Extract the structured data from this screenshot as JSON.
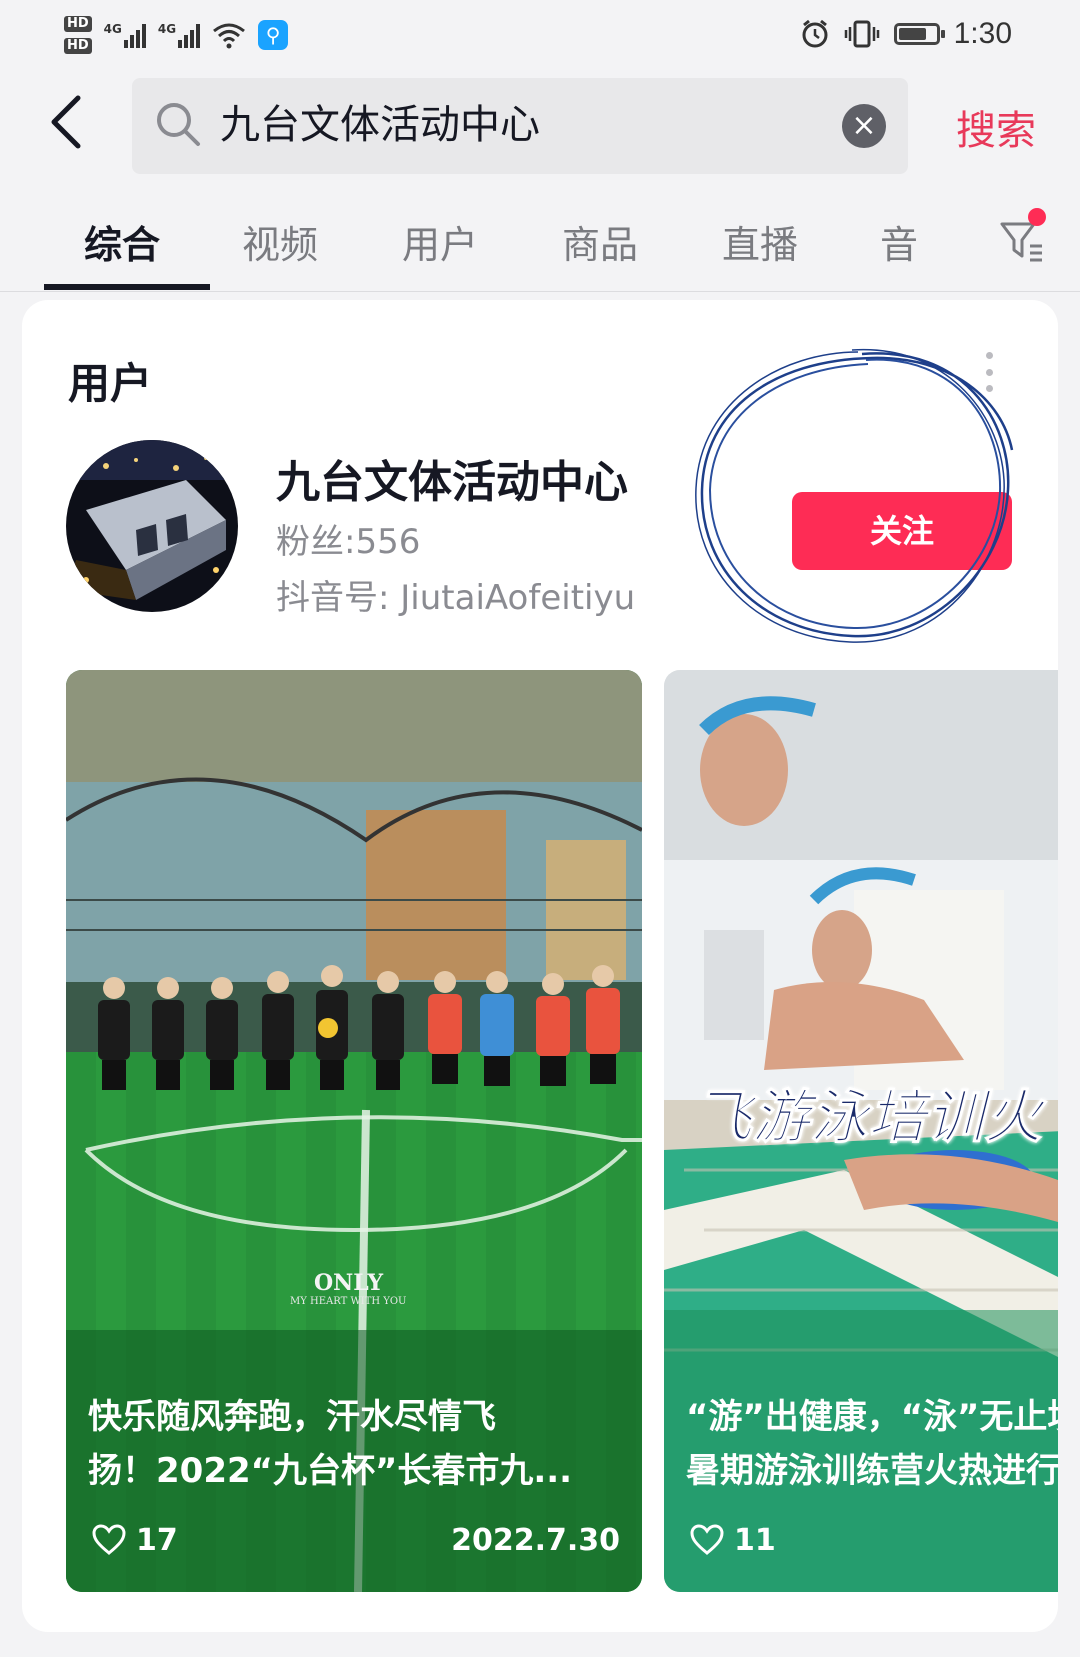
{
  "status_bar": {
    "hd1": "HD",
    "hd2": "HD",
    "net1": "4G",
    "net2": "4G",
    "time": "1:30",
    "battery_level": 0.75,
    "icons": [
      "alarm-icon",
      "vibrate-icon",
      "wifi-icon",
      "battery-icon"
    ]
  },
  "search": {
    "query": "九台文体活动中心",
    "submit_label": "搜索"
  },
  "tabs": [
    {
      "label": "综合",
      "active": true
    },
    {
      "label": "视频",
      "active": false
    },
    {
      "label": "用户",
      "active": false
    },
    {
      "label": "商品",
      "active": false
    },
    {
      "label": "直播",
      "active": false
    },
    {
      "label": "音",
      "active": false
    }
  ],
  "user_section": {
    "title": "用户",
    "user": {
      "name": "九台文体活动中心",
      "followers": "粉丝:556",
      "douyin_id": "抖音号: JiutaiAofeitiyu",
      "follow_label": "关注"
    }
  },
  "videos": [
    {
      "caption_line1": "快乐随风奔跑，汗水尽情飞",
      "caption_line2": "扬！2022“九台杯”长春市九...",
      "likes": "17",
      "date": "2022.7.30",
      "overlay_title": "ONLY",
      "overlay_sub": "MY HEART WITH YOU"
    },
    {
      "caption_line1": "“游”出健康，“泳”无止境",
      "caption_line2": "暑期游泳训练营火热进行中",
      "likes": "11",
      "overlay_banner": "飞游泳培训火"
    }
  ],
  "colors": {
    "accent": "#fe2c55",
    "search_submit": "#e8395a",
    "annotation_ink": "#1e3f8a"
  }
}
